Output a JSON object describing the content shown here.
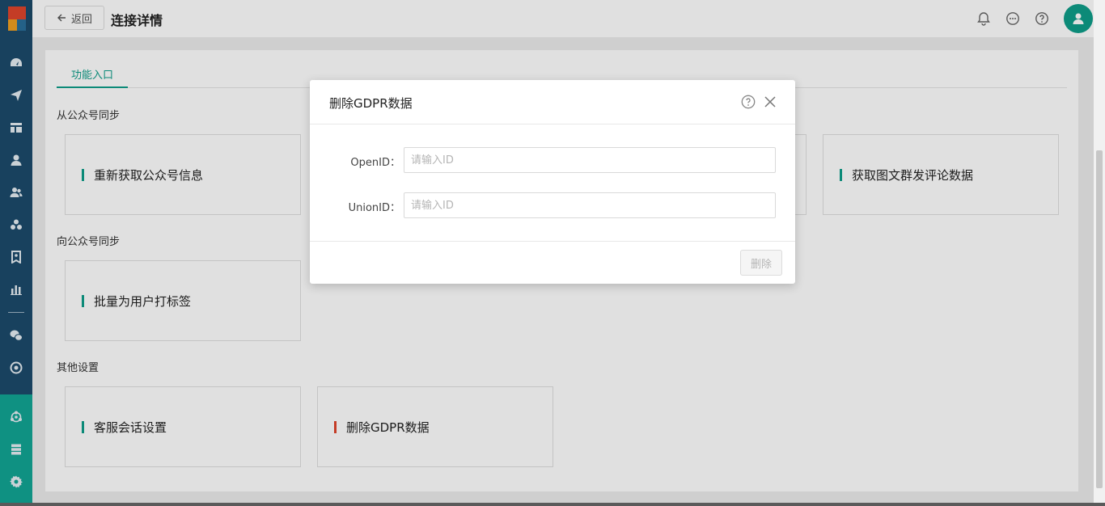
{
  "header": {
    "back_label": "返回",
    "title": "连接详情"
  },
  "tabs": [
    {
      "label": "功能入口",
      "active": true
    }
  ],
  "sections": [
    {
      "title": "从公众号同步",
      "cards": [
        "重新获取公众号信息",
        "获取图文群发评论数据"
      ]
    },
    {
      "title": "向公众号同步",
      "cards": [
        "批量为用户打标签"
      ]
    },
    {
      "title": "其他设置",
      "cards": [
        "客服会话设置",
        "删除GDPR数据"
      ]
    }
  ],
  "modal": {
    "title": "删除GDPR数据",
    "fields": [
      {
        "label": "OpenID：",
        "placeholder": "请输入ID",
        "value": ""
      },
      {
        "label": "UnionID：",
        "placeholder": "请输入ID",
        "value": ""
      }
    ],
    "delete_label": "删除"
  },
  "colors": {
    "accent": "#0e9e89",
    "nav_bg": "#1c4b6b",
    "danger_bar": "#e0452c"
  },
  "icons": {
    "nav": [
      "dashboard-icon",
      "send-icon",
      "layout-icon",
      "user-icon",
      "users-icon",
      "segments-icon",
      "bookmark-icon",
      "bar-chart-icon",
      "wechat-icon",
      "target-icon",
      "share-icon",
      "database-icon",
      "gear-icon"
    ],
    "header": [
      "bell-icon",
      "chat-icon",
      "help-icon",
      "avatar-icon"
    ]
  }
}
